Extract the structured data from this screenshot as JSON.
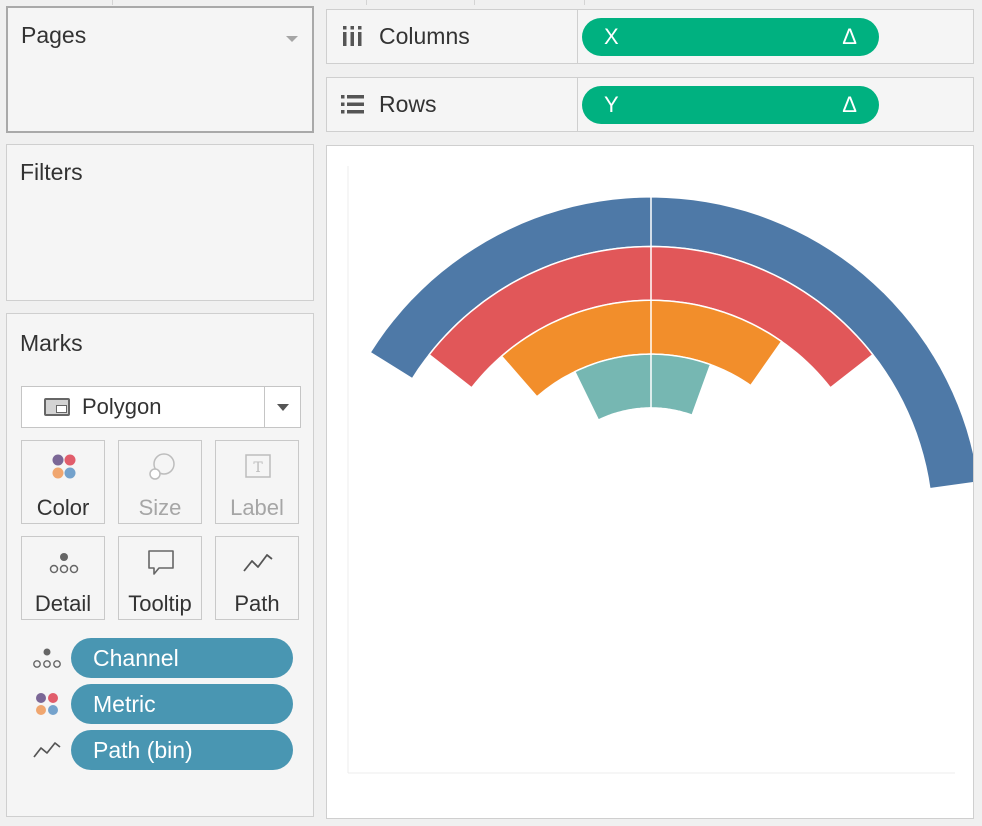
{
  "cards": {
    "pages": {
      "title": "Pages"
    },
    "filters": {
      "title": "Filters"
    },
    "marks": {
      "title": "Marks",
      "mark_type": "Polygon",
      "buttons": [
        {
          "label": "Color",
          "icon": "color-icon",
          "enabled": true
        },
        {
          "label": "Size",
          "icon": "size-icon",
          "enabled": false
        },
        {
          "label": "Label",
          "icon": "label-icon",
          "enabled": false
        },
        {
          "label": "Detail",
          "icon": "detail-icon",
          "enabled": true
        },
        {
          "label": "Tooltip",
          "icon": "tooltip-icon",
          "enabled": true
        },
        {
          "label": "Path",
          "icon": "path-icon",
          "enabled": true
        }
      ],
      "fields": [
        {
          "label": "Channel",
          "encoding": "detail-icon"
        },
        {
          "label": "Metric",
          "encoding": "color-icon"
        },
        {
          "label": "Path (bin)",
          "encoding": "path-icon"
        }
      ]
    }
  },
  "shelves": {
    "columns": {
      "label": "Columns",
      "pill": "X",
      "pill_icon": "Δ"
    },
    "rows": {
      "label": "Rows",
      "pill": "Y",
      "pill_icon": "Δ"
    }
  },
  "colors": {
    "pill_dimension": "#4996b2",
    "pill_measure": "#00b180",
    "series": [
      "#4e79a7",
      "#e15759",
      "#f28e2b",
      "#76b7b2"
    ]
  },
  "chart_data": {
    "type": "area",
    "description_type": "polygon arcs (funnel/rainbow)",
    "xlabel": "",
    "ylabel": "",
    "grid": false,
    "series": [
      {
        "color": "#4e79a7",
        "arc": {
          "start_deg": -148,
          "end_deg": -8,
          "inner_r": 0.68,
          "outer_r": 0.8
        }
      },
      {
        "color": "#e15759",
        "arc": {
          "start_deg": -142,
          "end_deg": -38,
          "inner_r": 0.55,
          "outer_r": 0.68
        }
      },
      {
        "color": "#f28e2b",
        "arc": {
          "start_deg": -131,
          "end_deg": -55,
          "inner_r": 0.42,
          "outer_r": 0.55
        }
      },
      {
        "color": "#76b7b2",
        "arc": {
          "start_deg": -116,
          "end_deg": -70,
          "inner_r": 0.29,
          "outer_r": 0.42
        }
      }
    ]
  }
}
